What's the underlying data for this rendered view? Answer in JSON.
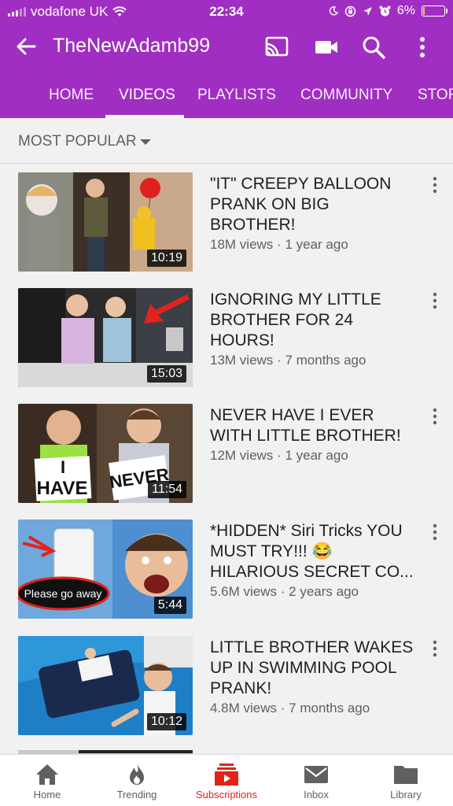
{
  "status_bar": {
    "carrier": "vodafone UK",
    "time": "22:34",
    "battery": "6%",
    "battery_level": 0.06
  },
  "app_bar": {
    "title": "TheNewAdamb99",
    "icons": [
      "back-arrow-icon",
      "cast-icon",
      "video-camera-icon",
      "search-icon",
      "more-vert-icon"
    ]
  },
  "tabs": [
    {
      "label": "HOME"
    },
    {
      "label": "VIDEOS",
      "active": true
    },
    {
      "label": "PLAYLISTS"
    },
    {
      "label": "COMMUNITY"
    },
    {
      "label": "STORE"
    }
  ],
  "sort": {
    "label": "MOST POPULAR"
  },
  "videos": [
    {
      "title": "\"IT\" CREEPY BALLOON PRANK ON BIG BROTHER!",
      "views": "18M views",
      "age": "1 year ago",
      "duration": "10:19"
    },
    {
      "title": "IGNORING MY LITTLE BROTHER FOR 24 HOURS!",
      "views": "13M views",
      "age": "7 months ago",
      "duration": "15:03"
    },
    {
      "title": "NEVER HAVE I EVER WITH LITTLE BROTHER!",
      "views": "12M views",
      "age": "1 year ago",
      "duration": "11:54"
    },
    {
      "title": "*HIDDEN* Siri Tricks YOU MUST TRY!!! 😂 HILARIOUS SECRET CO...",
      "views": "5.6M views",
      "age": "2 years ago",
      "duration": "5:44"
    },
    {
      "title": "LITTLE BROTHER WAKES UP IN SWIMMING POOL PRANK!",
      "views": "4.8M views",
      "age": "7 months ago",
      "duration": "10:12"
    }
  ],
  "thumb_text": {
    "have_i": "I",
    "have": "HAVE",
    "never": "NEVER",
    "siri_bubble": "Please go away"
  },
  "meta_separator": "·",
  "bottom_nav": [
    {
      "label": "Home",
      "icon": "home-icon"
    },
    {
      "label": "Trending",
      "icon": "flame-icon"
    },
    {
      "label": "Subscriptions",
      "icon": "subscriptions-icon",
      "active": true
    },
    {
      "label": "Inbox",
      "icon": "inbox-icon"
    },
    {
      "label": "Library",
      "icon": "folder-icon"
    }
  ],
  "colors": {
    "brand": "#a12ec2",
    "active_nav": "#e62117",
    "background": "#f1f1f1"
  }
}
